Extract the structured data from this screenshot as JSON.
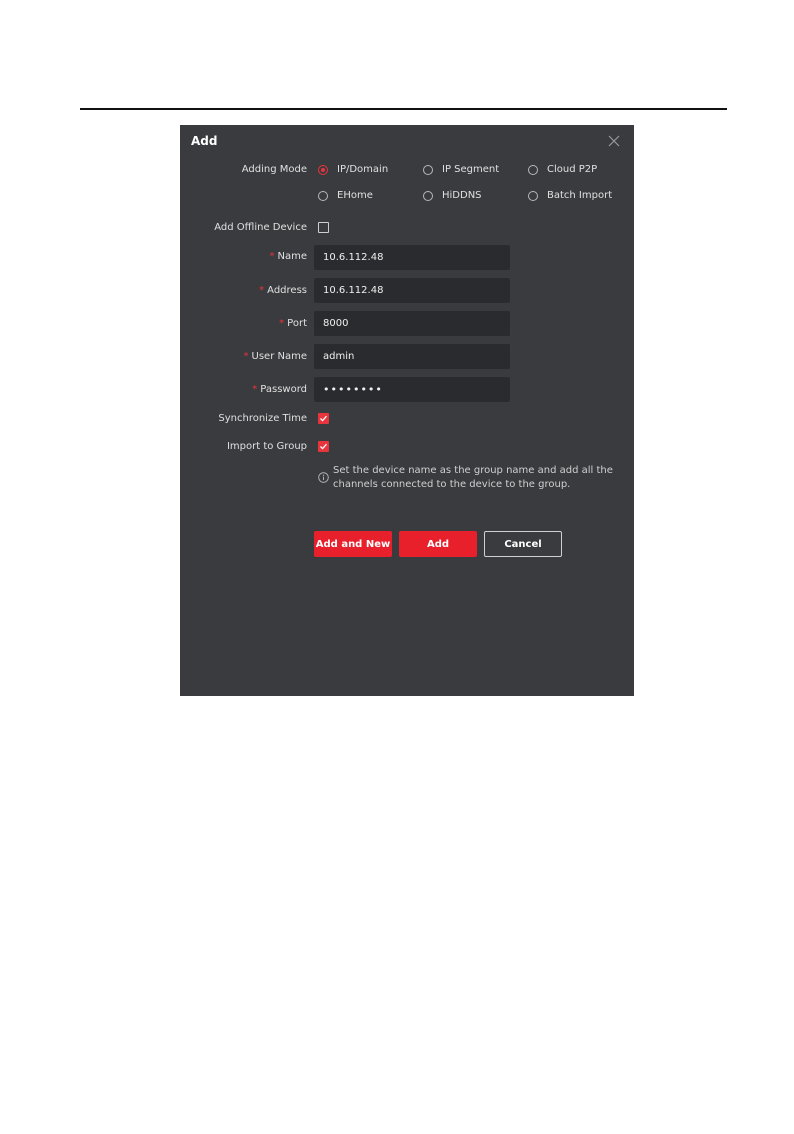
{
  "dialog": {
    "title": "Add",
    "adding_mode_label": "Adding Mode",
    "modes": [
      "IP/Domain",
      "IP Segment",
      "Cloud P2P",
      "EHome",
      "HiDDNS",
      "Batch Import"
    ],
    "selected_mode": "IP/Domain",
    "offline_label": "Add Offline Device",
    "offline_checked": false,
    "fields": {
      "name": {
        "label": "Name",
        "value": "10.6.112.48"
      },
      "address": {
        "label": "Address",
        "value": "10.6.112.48"
      },
      "port": {
        "label": "Port",
        "value": "8000"
      },
      "username": {
        "label": "User Name",
        "value": "admin"
      },
      "password": {
        "label": "Password",
        "value": "••••••••"
      }
    },
    "required_mark": "*",
    "sync_time_label": "Synchronize Time",
    "sync_time_checked": true,
    "import_group_label": "Import to Group",
    "import_group_checked": true,
    "info_text": "Set the device name as the group name and add all the channels connected to the device to the group.",
    "buttons": {
      "add_and_new": "Add and New",
      "add": "Add",
      "cancel": "Cancel"
    },
    "accent_color": "#e8343c"
  }
}
